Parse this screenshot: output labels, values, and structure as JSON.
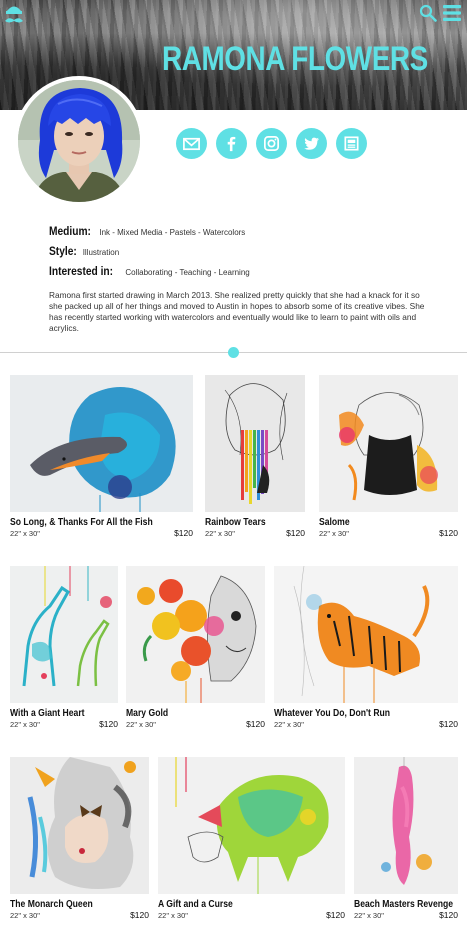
{
  "header": {
    "artist_name": "RAMONA FLOWERS",
    "logo_icon": "mustache-hat-logo",
    "search_icon": "search-icon",
    "menu_icon": "hamburger-menu-icon"
  },
  "social": [
    {
      "icon": "mail-icon"
    },
    {
      "icon": "facebook-icon"
    },
    {
      "icon": "instagram-icon"
    },
    {
      "icon": "twitter-icon"
    },
    {
      "icon": "website-icon"
    }
  ],
  "profile": {
    "medium_label": "Medium:",
    "medium_value": "Ink - Mixed Media - Pastels - Watercolors",
    "style_label": "Style:",
    "style_value": "Illustration",
    "interested_label": "Interested in:",
    "interested_value": "Collaborating - Teaching - Learning",
    "bio": "Ramona first started drawing in March 2013. She realized pretty quickly that she had a knack for it so she packed up all of her things and moved to Austin in hopes to absorb some of its creative vibes. She has recently started working with watercolors and eventually would like to learn to paint with oils and acrylics."
  },
  "colors": {
    "accent": "#5fe0e4"
  },
  "artworks": [
    {
      "title": "So Long, & Thanks For All the Fish",
      "size": "22\" x 30\"",
      "price": "$120"
    },
    {
      "title": "Rainbow Tears",
      "size": "22\" x 30\"",
      "price": "$120"
    },
    {
      "title": "Salome",
      "size": "22\" x 30\"",
      "price": "$120"
    },
    {
      "title": "With a Giant Heart",
      "size": "22\" x 30\"",
      "price": "$120"
    },
    {
      "title": "Mary Gold",
      "size": "22\" x 30\"",
      "price": "$120"
    },
    {
      "title": "Whatever You Do, Don't Run",
      "size": "22\" x 30\"",
      "price": "$120"
    },
    {
      "title": "The Monarch Queen",
      "size": "22\" x 30\"",
      "price": "$120"
    },
    {
      "title": "A Gift and a Curse",
      "size": "22\" x 30\"",
      "price": "$120"
    },
    {
      "title": "Beach Masters Revenge",
      "size": "22\" x 30\"",
      "price": "$120"
    }
  ]
}
